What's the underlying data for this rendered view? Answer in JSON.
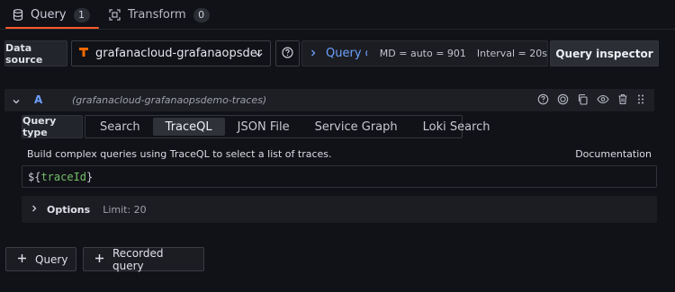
{
  "tabs": [
    {
      "label": "Query",
      "count": "1"
    },
    {
      "label": "Transform",
      "count": "0"
    }
  ],
  "toolbar": {
    "datasource_label": "Data source",
    "datasource_value": "grafanacloud-grafanaopsdemo-traces",
    "query_options_label": "Query opti...",
    "md": "MD = auto = 901",
    "interval": "Interval = 20s",
    "inspector_label": "Query inspector"
  },
  "query_row": {
    "ref_id": "A",
    "datasource": "(grafanacloud-grafanaopsdemo-traces)"
  },
  "query_type": {
    "label": "Query type",
    "options": [
      "Search",
      "TraceQL",
      "JSON File",
      "Service Graph",
      "Loki Search"
    ],
    "selected": "TraceQL"
  },
  "editor": {
    "help_text": "Build complex queries using TraceQL to select a list of traces.",
    "documentation_label": "Documentation",
    "prefix": "${",
    "variable": "traceId",
    "suffix": "}"
  },
  "options": {
    "label": "Options",
    "limit": "Limit: 20"
  },
  "buttons": {
    "add_query": "Query",
    "recorded_query": "Recorded query"
  },
  "colors": {
    "accent": "#ff5a2c",
    "link": "#6e9fff",
    "variable": "#73bf69"
  }
}
